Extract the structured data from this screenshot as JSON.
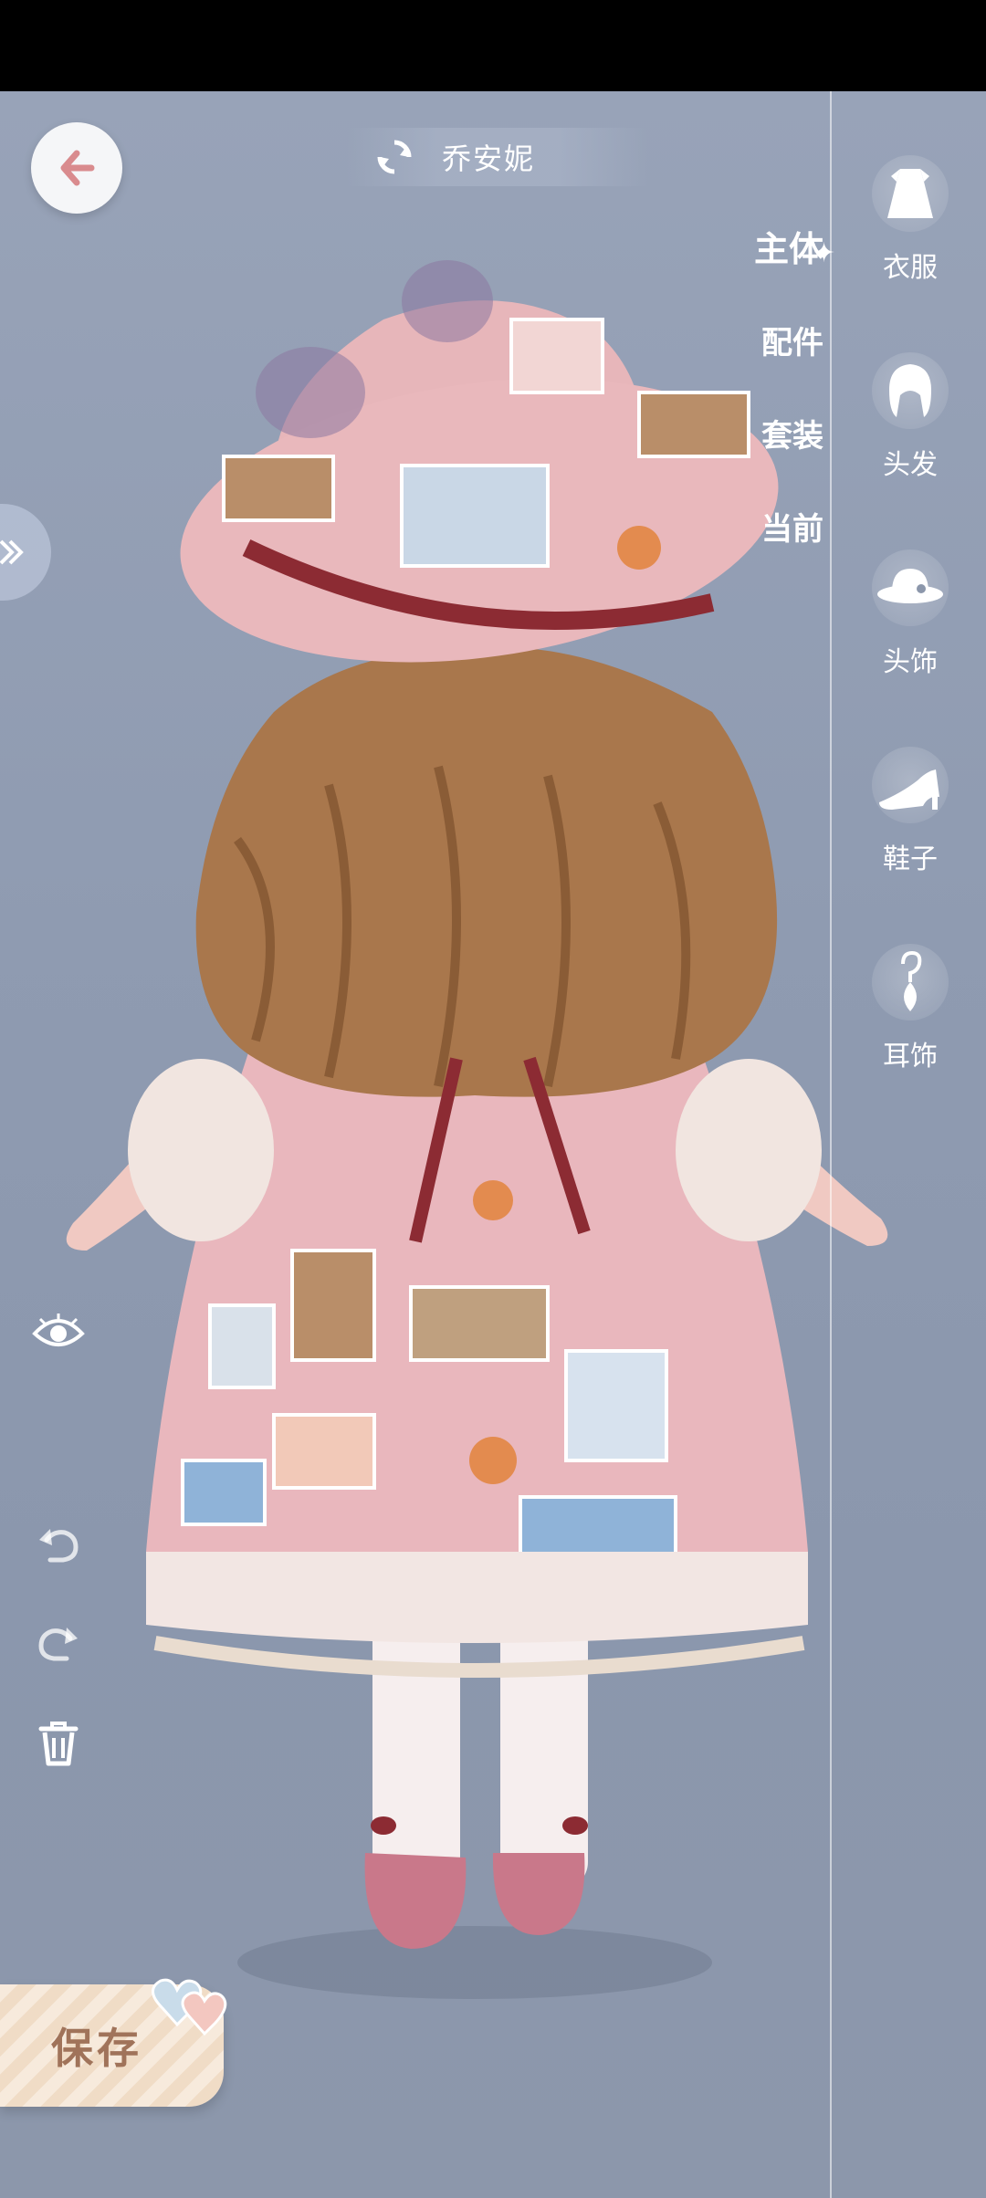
{
  "header": {
    "character_name": "乔安妮",
    "back_icon": "back-arrow-icon",
    "switch_icon": "swap-icon"
  },
  "categories": {
    "main": "主体",
    "accessories": "配件",
    "outfit_set": "套装",
    "current": "当前"
  },
  "rail": [
    {
      "label": "衣服",
      "icon": "dress-icon"
    },
    {
      "label": "头发",
      "icon": "hair-icon"
    },
    {
      "label": "头饰",
      "icon": "hat-icon"
    },
    {
      "label": "鞋子",
      "icon": "shoe-icon"
    },
    {
      "label": "耳饰",
      "icon": "earring-icon"
    }
  ],
  "tools": {
    "visibility": "eye-icon",
    "undo": "undo-icon",
    "redo": "redo-icon",
    "delete": "trash-icon"
  },
  "save": {
    "label": "保存"
  },
  "colors": {
    "background": "#8f9bb1",
    "dress": "#e9b7bd",
    "hair": "#a9774c",
    "ribbon": "#8c2b33",
    "save_text": "#a0735a"
  }
}
